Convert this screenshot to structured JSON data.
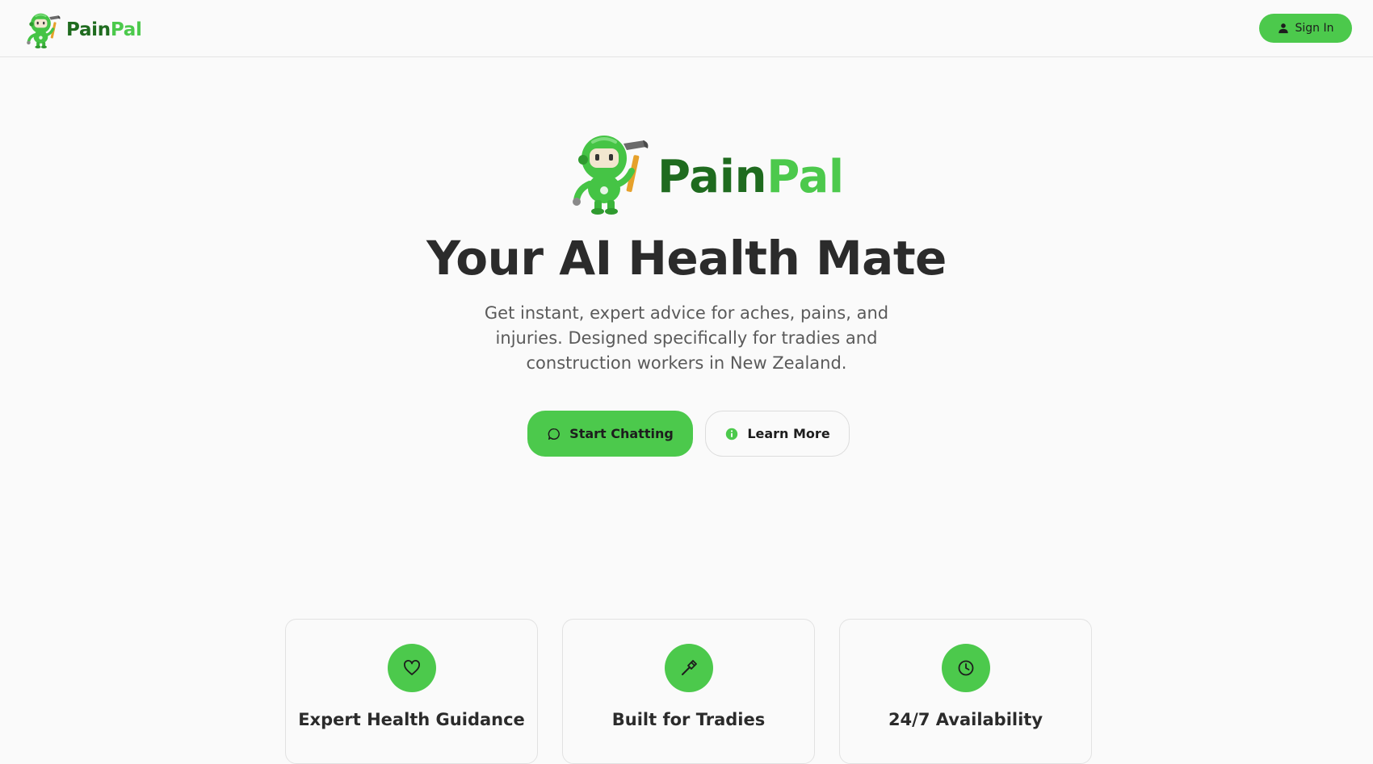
{
  "brand": {
    "name_part1": "Pain",
    "name_part2": "Pal",
    "primary_color": "#4cc94c",
    "dark_color": "#1f6b1f"
  },
  "header": {
    "signin_label": "Sign In"
  },
  "hero": {
    "title": "Your AI Health Mate",
    "subtitle": "Get instant, expert advice for aches, pains, and injuries. Designed specifically for tradies and construction workers in New Zealand.",
    "primary_button": "Start Chatting",
    "secondary_button": "Learn More"
  },
  "features": [
    {
      "title": "Expert Health Guidance",
      "icon": "heart-icon"
    },
    {
      "title": "Built for Tradies",
      "icon": "hammer-icon"
    },
    {
      "title": "24/7 Availability",
      "icon": "clock-icon"
    }
  ]
}
